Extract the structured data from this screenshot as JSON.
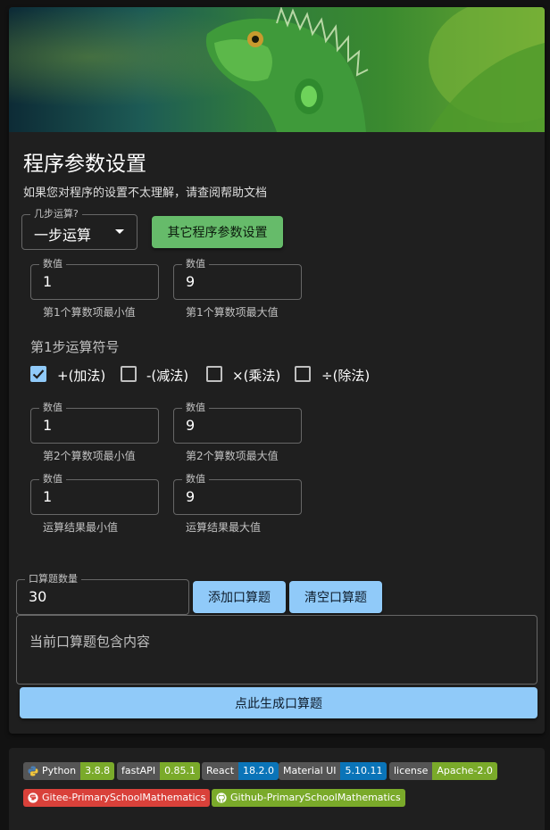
{
  "form": {
    "title": "程序参数设置",
    "subtitle": "如果您对程序的设置不太理解，请查阅帮助文档",
    "steps_select": {
      "label": "几步运算?",
      "value": "一步运算"
    },
    "other_settings_button": "其它程序参数设置",
    "operand1_min": {
      "label": "数值",
      "value": "1",
      "helper": "第1个算数项最小值"
    },
    "operand1_max": {
      "label": "数值",
      "value": "9",
      "helper": "第1个算数项最大值"
    },
    "operator_section_label": "第1步运算符号",
    "operators": [
      {
        "label": "+(加法)",
        "checked": true
      },
      {
        "label": "-(减法)",
        "checked": false
      },
      {
        "label": "×(乘法)",
        "checked": false
      },
      {
        "label": "÷(除法)",
        "checked": false
      }
    ],
    "operand2_min": {
      "label": "数值",
      "value": "1",
      "helper": "第2个算数项最小值"
    },
    "operand2_max": {
      "label": "数值",
      "value": "9",
      "helper": "第2个算数项最大值"
    },
    "result_min": {
      "label": "数值",
      "value": "1",
      "helper": "运算结果最小值"
    },
    "result_max": {
      "label": "数值",
      "value": "9",
      "helper": "运算结果最大值"
    },
    "problem_count": {
      "label": "口算题数量",
      "value": "30"
    },
    "add_button": "添加口算题",
    "clear_button": "清空口算题",
    "content_placeholder": "当前口算题包含内容",
    "generate_button": "点此生成口算题"
  },
  "badges": [
    {
      "key": "Python",
      "value": "3.8.8",
      "color": "#7aaa2a",
      "icon": "python-icon"
    },
    {
      "key": "fastAPI",
      "value": "0.85.1",
      "color": "#7aaa2a"
    },
    {
      "key": "React",
      "value": "18.2.0",
      "color": "#0a74b8"
    },
    {
      "key": "Material UI",
      "value": "5.10.11",
      "color": "#0a74b8"
    },
    {
      "key": "license",
      "value": "Apache-2.0",
      "color": "#7aaa2a"
    },
    {
      "label": "Gitee-PrimarySchoolMathematics",
      "color": "#d9413a",
      "icon": "gitee-icon"
    },
    {
      "label": "Github-PrimarySchoolMathematics",
      "color": "#7aaa2a",
      "icon": "github-icon"
    }
  ],
  "colors": {
    "primary_blue": "#90caf9",
    "success_green": "#66bb6a",
    "surface": "#1f1f1f",
    "background": "#121212"
  }
}
